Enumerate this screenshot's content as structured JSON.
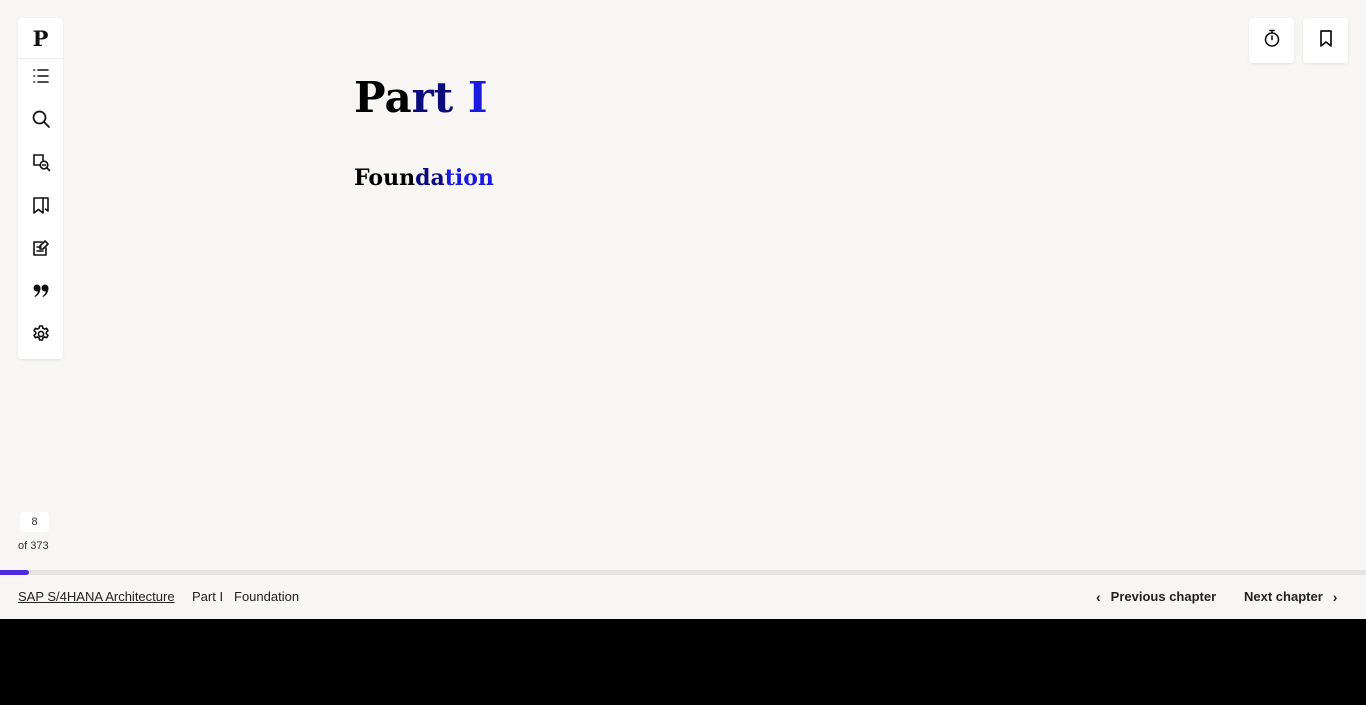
{
  "toolbar": {
    "logo": "P",
    "items": [
      {
        "name": "contents-icon"
      },
      {
        "name": "search-icon"
      },
      {
        "name": "search-highlights-icon"
      },
      {
        "name": "bookmarks-icon"
      },
      {
        "name": "notes-icon"
      },
      {
        "name": "quotes-icon"
      },
      {
        "name": "settings-icon"
      }
    ]
  },
  "top_actions": {
    "timer_icon": "timer-icon",
    "bookmark_icon": "bookmark-icon"
  },
  "content": {
    "title_a": "Pa",
    "title_b": "rt ",
    "title_c": "I",
    "subtitle_a": "Foun",
    "subtitle_b": "da",
    "subtitle_c": "tion"
  },
  "pager": {
    "current": "8",
    "total": "of 373",
    "progress_fraction": 0.021
  },
  "footer": {
    "book": "SAP S/4HANA Architecture",
    "part": "Part I",
    "chapter": "Foundation",
    "prev": "Previous chapter",
    "next": "Next chapter"
  },
  "colors": {
    "accent": "#4a2be0",
    "background": "#f7f6f4"
  }
}
